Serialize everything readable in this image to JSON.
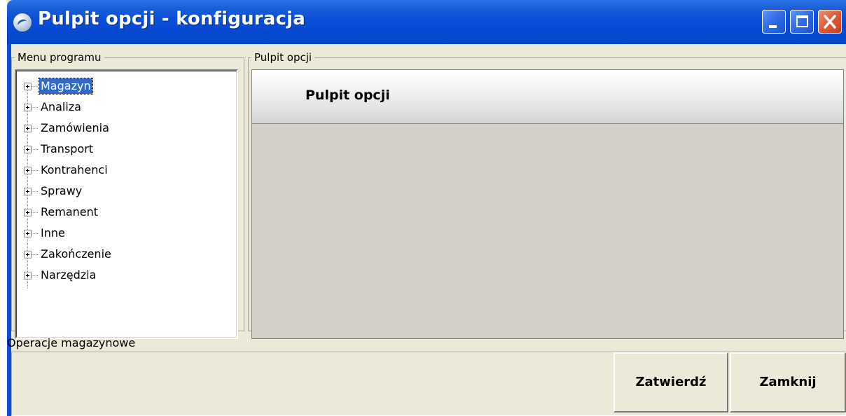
{
  "window": {
    "title": "Pulpit opcji - konfiguracja"
  },
  "menu_group": {
    "legend": "Menu programu",
    "items": [
      {
        "label": "Magazyn",
        "selected": true
      },
      {
        "label": "Analiza"
      },
      {
        "label": "Zamówienia"
      },
      {
        "label": "Transport"
      },
      {
        "label": "Kontrahenci"
      },
      {
        "label": "Sprawy"
      },
      {
        "label": "Remanent"
      },
      {
        "label": "Inne"
      },
      {
        "label": "Zakończenie"
      },
      {
        "label": "Narzędzia"
      }
    ]
  },
  "options_group": {
    "legend": "Pulpit opcji",
    "header_title": "Pulpit opcji"
  },
  "status": {
    "text": "Operacje magazynowe"
  },
  "buttons": {
    "confirm": "Zatwierdź",
    "close": "Zamknij"
  },
  "colors": {
    "titlebar": "#0a50dc",
    "selection": "#316ac5",
    "dialog_bg": "#ece9d8",
    "close_button": "#dd5a35"
  },
  "icons": {
    "app": "app-globe-icon",
    "tree_expander": "plus-expander-icon"
  }
}
